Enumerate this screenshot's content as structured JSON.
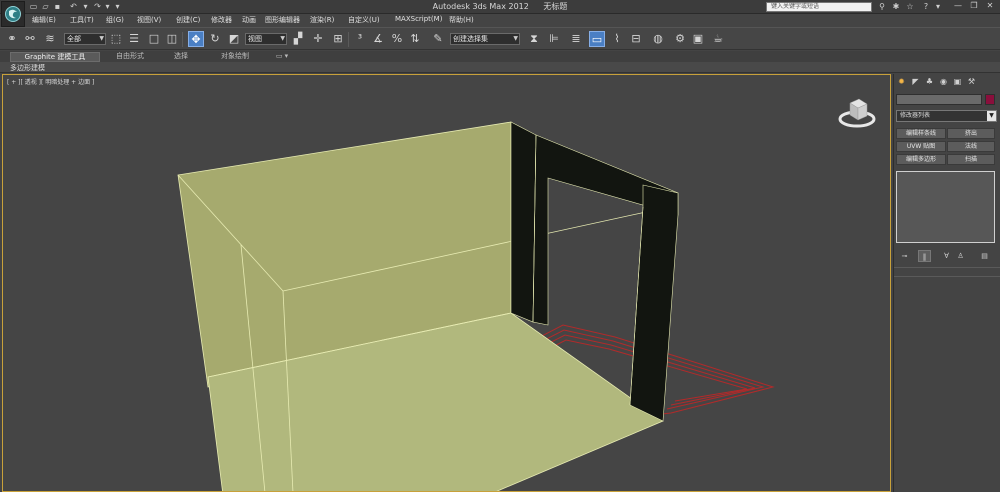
{
  "window": {
    "app_title": "Autodesk 3ds Max  2012",
    "doc_title": "无标题",
    "search_placeholder": "键入关键字或短语"
  },
  "menu": [
    "编辑(E)",
    "工具(T)",
    "组(G)",
    "视图(V)",
    "创建(C)",
    "修改器",
    "动画",
    "图形编辑器",
    "渲染(R)",
    "自定义(U)",
    "MAXScript(M)",
    "帮助(H)"
  ],
  "toolbar": {
    "selection_filter": "全部",
    "reference_coord": "视图",
    "named_selection": "创建选择集"
  },
  "ribbon": {
    "tabs": [
      "Graphite 建模工具",
      "自由形式",
      "选择",
      "对象绘制"
    ],
    "active_tab": 0,
    "panel_label": "多边形建模"
  },
  "viewport": {
    "label": "[ + ][ 透视 ][ 明暗处理 + 边面 ]"
  },
  "command_panel": {
    "modifier_list": "修改器列表",
    "buttons": [
      "编辑样条线",
      "挤出",
      "UVW 贴图",
      "法线",
      "编辑多边形",
      "扫描"
    ],
    "object_color": "#8a0f3c"
  },
  "colors": {
    "wall_fill": "#a6aa6e",
    "floor_fill": "#b1b87d",
    "door_frame": "#121510",
    "wire_edge": "#e7ebb2",
    "grid_red": "#b12a2a",
    "active_blue": "#4a7fc4",
    "viewport_border": "#c8a13a"
  }
}
